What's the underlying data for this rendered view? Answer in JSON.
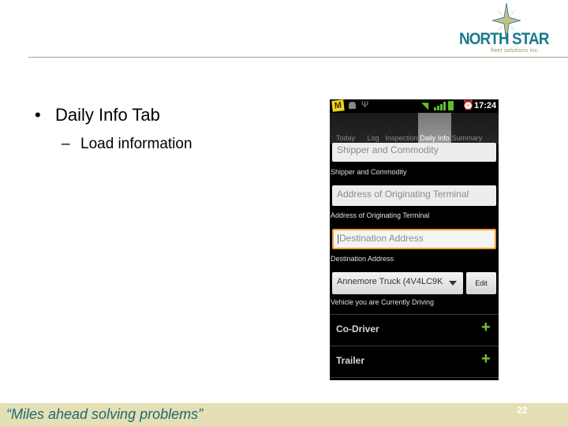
{
  "slide": {
    "logo": {
      "name": "NORTH STAR",
      "tagline": "fleet solutions inc."
    },
    "bullets": [
      {
        "marker": "•",
        "text": "Daily Info Tab"
      },
      {
        "marker": "–",
        "text": "Load information"
      }
    ],
    "footer": {
      "quote": "“Miles ahead solving problems”",
      "page_number": "22"
    },
    "colors": {
      "brand_teal": "#1b7a8c",
      "footer_bg": "#e5dfb5",
      "accent_green": "#7cc43a",
      "focus_orange": "#f19a2a"
    }
  },
  "phone": {
    "status_bar": {
      "app_icon": "M",
      "icons": [
        "m-app-icon",
        "android-icon",
        "usb-icon",
        "wifi-icon",
        "signal-icon",
        "battery-icon",
        "alarm-icon"
      ],
      "time": "17:24"
    },
    "tabs": [
      {
        "label": "Today",
        "active": false
      },
      {
        "label": "Log",
        "active": false
      },
      {
        "label": "Inspection",
        "active": false
      },
      {
        "label": "Daily Info",
        "active": true
      },
      {
        "label": "Summary",
        "active": false
      }
    ],
    "form": {
      "shipper": {
        "placeholder": "Shipper and Commodity",
        "label": "Shipper and Commodity"
      },
      "origin": {
        "placeholder": "Address of Originating Terminal",
        "label": "Address of Originating Terminal"
      },
      "destination": {
        "placeholder": "Destination Address",
        "label": "Destination Address"
      },
      "vehicle": {
        "selected": "Annemore Truck (4V4LC9K",
        "edit_label": "Edit",
        "label": "Vehicle you are Currently Driving"
      }
    },
    "sections": [
      {
        "label": "Co-Driver",
        "action": "+"
      },
      {
        "label": "Trailer",
        "action": "+"
      }
    ]
  }
}
